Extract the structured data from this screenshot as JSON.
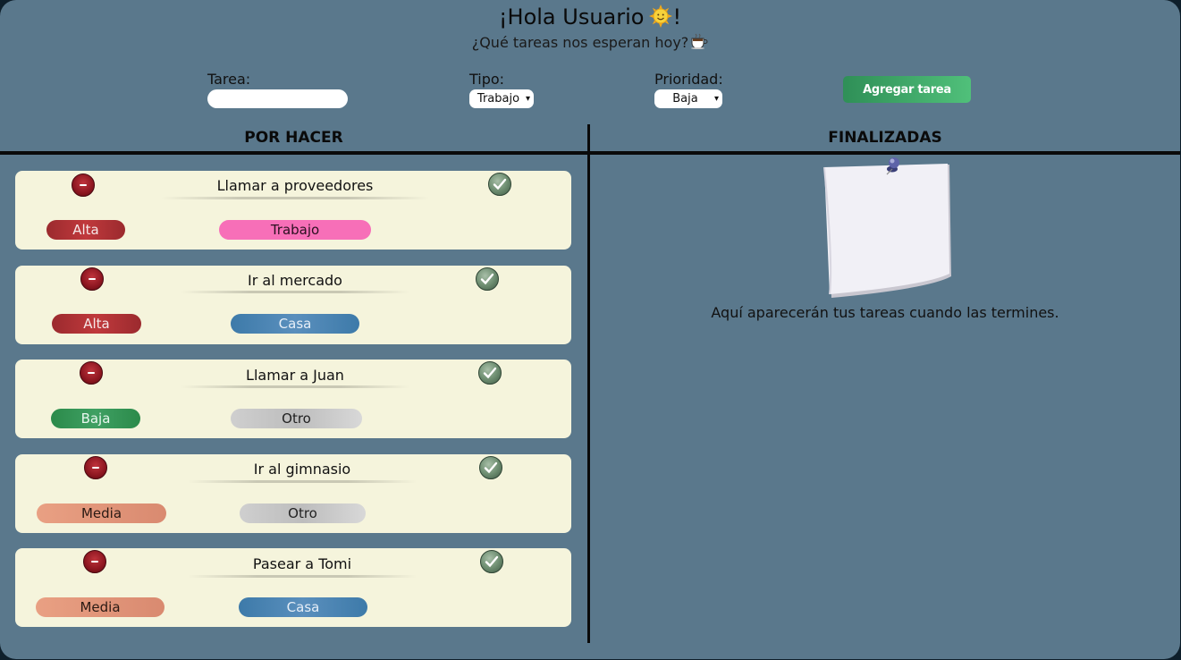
{
  "header": {
    "greeting": "¡Hola Usuario",
    "greeting_end": "!",
    "subtitle": "¿Qué tareas nos esperan hoy?"
  },
  "form": {
    "task_label": "Tarea:",
    "task_value": "",
    "type_label": "Tipo:",
    "type_value": "Trabajo",
    "priority_label": "Prioridad:",
    "priority_value": "Baja",
    "add_label": "Agregar tarea"
  },
  "columns": {
    "todo_title": "POR HACER",
    "done_title": "FINALIZADAS"
  },
  "tasks": [
    {
      "name": "Llamar a proveedores",
      "priority": "Alta",
      "type": "Trabajo"
    },
    {
      "name": "Ir al mercado",
      "priority": "Alta",
      "type": "Casa"
    },
    {
      "name": "Llamar a Juan",
      "priority": "Baja",
      "type": "Otro"
    },
    {
      "name": "Ir al gimnasio",
      "priority": "Media",
      "type": "Otro"
    },
    {
      "name": "Pasear a Tomi",
      "priority": "Media",
      "type": "Casa"
    }
  ],
  "done": {
    "empty_message": "Aquí aparecerán tus tareas cuando las termines."
  },
  "colors": {
    "background": "#5a788c",
    "card": "#f5f4dc",
    "alta": "#b3353a",
    "baja": "#2f9153",
    "media": "#e4977c",
    "trabajo": "#f76fb8",
    "casa": "#4a85b3",
    "otro": "#c9c9c9",
    "add_button": "#3fa668"
  },
  "icons": {
    "sun": "sun-emoji-icon",
    "coffee": "coffee-cup-icon",
    "delete": "minus-circle-icon",
    "complete": "check-circle-icon",
    "note": "pinned-sticky-note-icon"
  }
}
